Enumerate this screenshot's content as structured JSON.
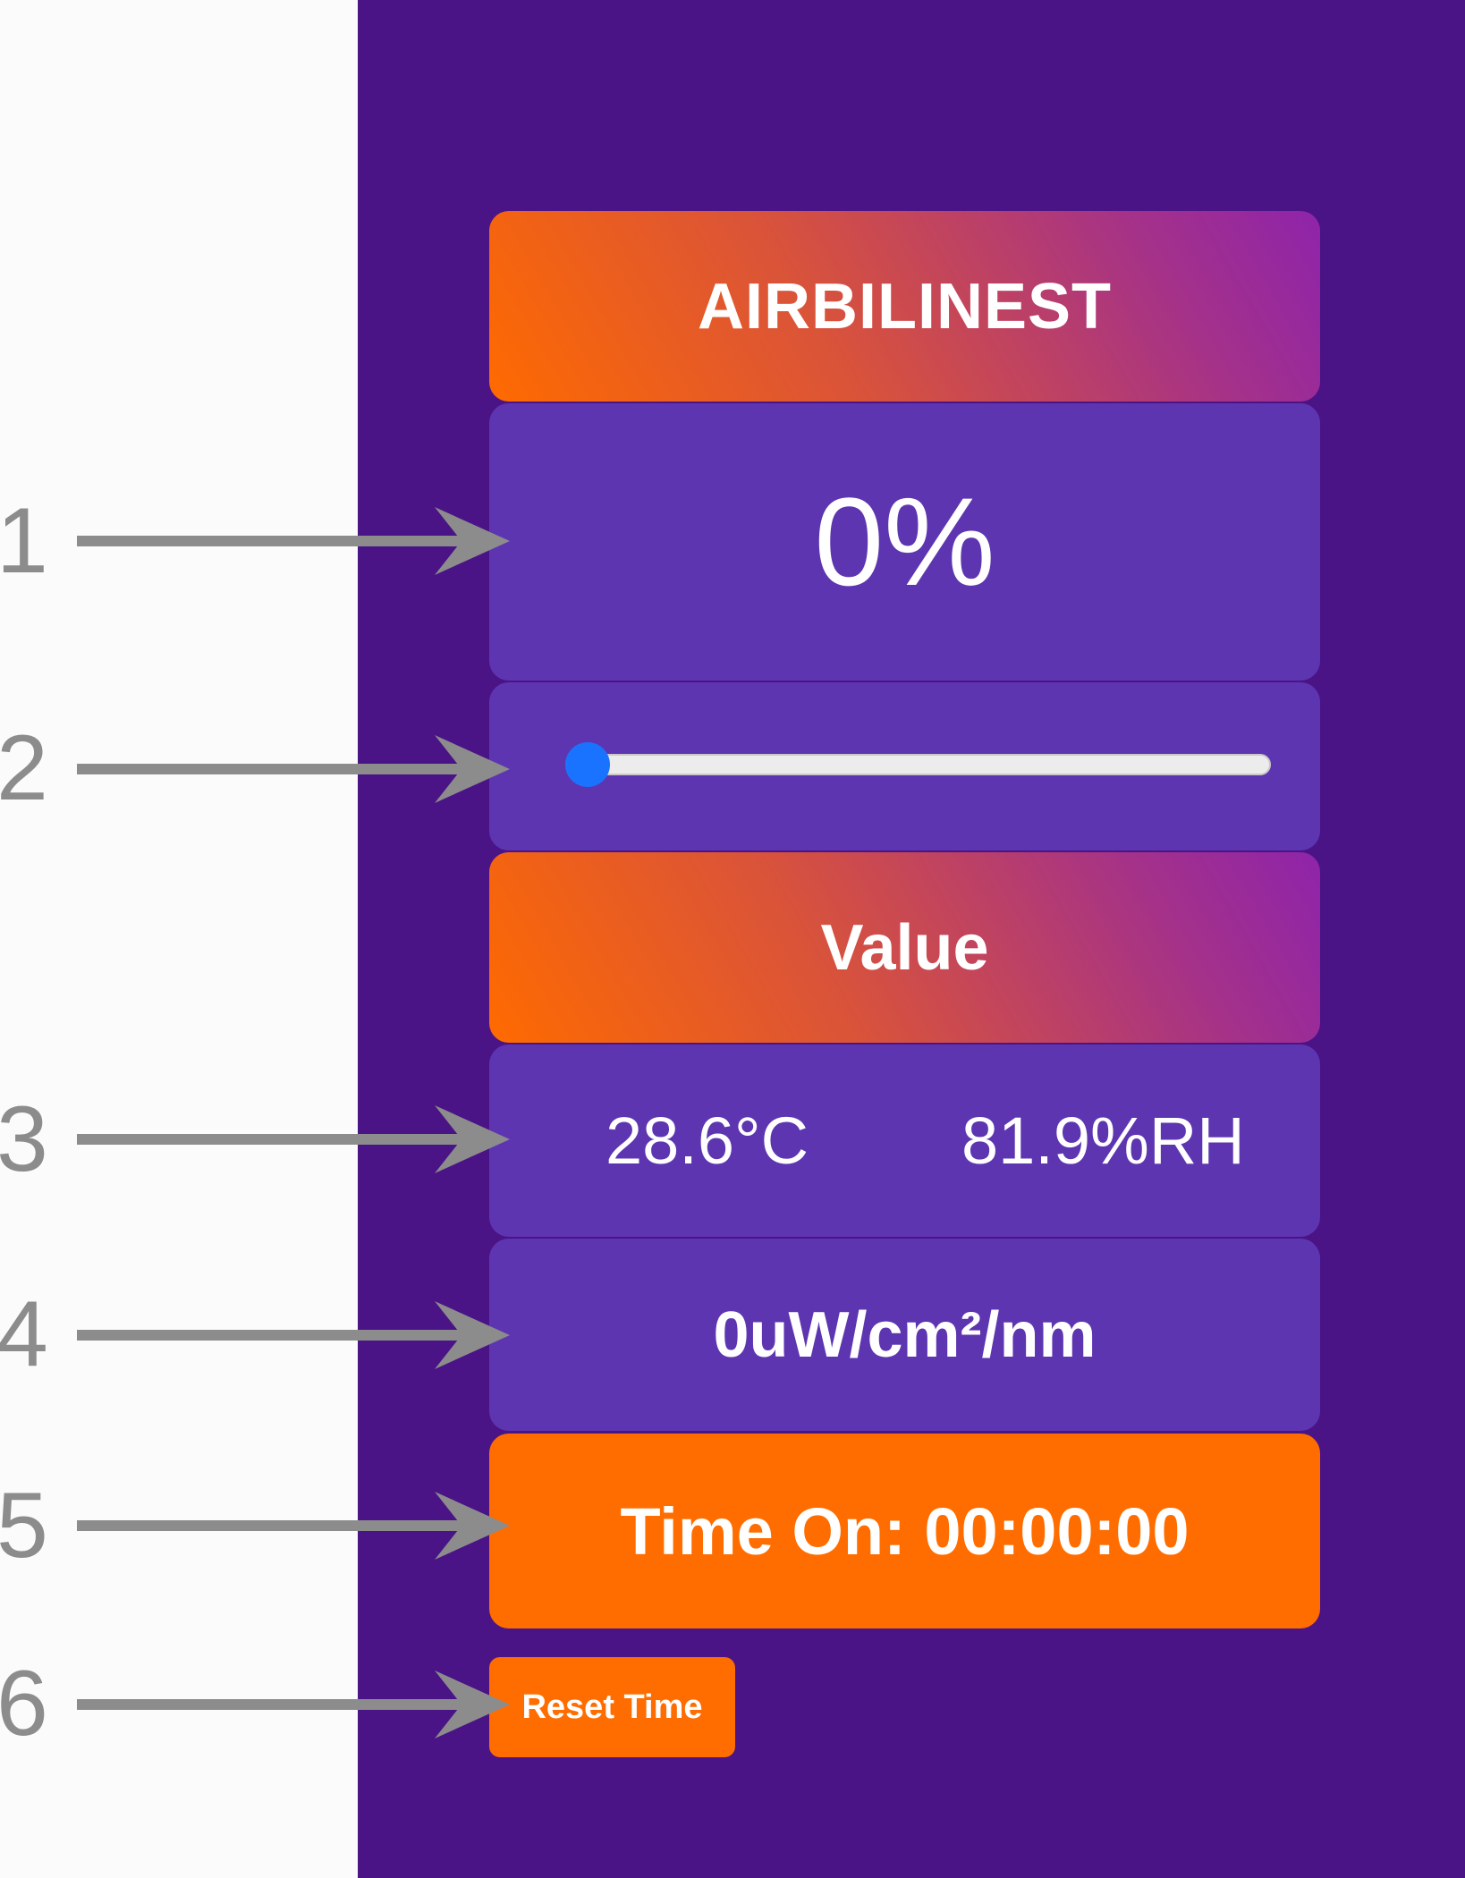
{
  "app": {
    "title": "AIRBILINEST",
    "percent_display": "0%",
    "slider_value": 0,
    "value_label": "Value",
    "temperature": "28.6°C",
    "humidity": "81.9%RH",
    "irradiance": "0uW/cm²/nm",
    "time_on": "Time On: 00:00:00",
    "reset_button_label": "Reset Time"
  },
  "callouts": [
    "1",
    "2",
    "3",
    "4",
    "5",
    "6"
  ],
  "colors": {
    "background": "#4a1486",
    "card_violet": "#5e35b1",
    "accent_orange": "#ff6d00",
    "gradient_start": "#ff6a00",
    "gradient_end": "#8e24aa",
    "slider_thumb": "#1a73ff",
    "callout_gray": "#8c8c8c"
  },
  "icons": {
    "callout": "arrow-right-icon"
  }
}
